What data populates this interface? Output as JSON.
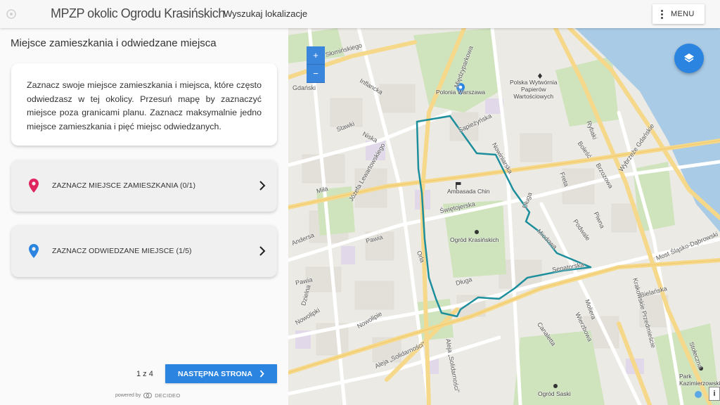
{
  "header": {
    "title": "MPZP okolic Ogrodu Krasińskich",
    "search_label": "Wyszukaj lokalizacje",
    "menu_label": "MENU"
  },
  "panel": {
    "heading": "Miejsce zamieszkania i odwiedzane miejsca",
    "instructions": "Zaznacz swoje miejsce zamieszkania i miejsca, które często odwiedzasz w tej okolicy. Przesuń mapę by zaznaczyć miejsce poza granicami planu. Zaznacz maksymalnie jedno miejsce zamieszkania i pięć miejsc odwiedzanych.",
    "home_action": "ZAZNACZ MIEJSCE ZAMIESZKANIA (0/1)",
    "visited_action": "ZAZNACZ ODWIEDZANE MIEJSCE (1/5)",
    "pager": "1 z 4",
    "next_label": "NASTĘPNA STRONA",
    "powered_by": "powered by",
    "powered_brand": "DECIDEO"
  },
  "map": {
    "zoom_in": "+",
    "zoom_out": "−",
    "info": "i",
    "labels": {
      "stawki": "Stawki",
      "inflancka": "Inflancka",
      "niska": "Niska",
      "mila": "Miła",
      "jozefa": "Józefa Lewartowskiego",
      "pawia": "Pawia",
      "solidarnosci": "Aleja „Solidarności”",
      "solidarnosci2": "Aleja „Solidarności”",
      "nowolipie": "Nowolipie",
      "nowolipki": "Nowolipki",
      "dluga": "Długa",
      "dluga2": "Długa",
      "swietojerska": "Świętojerska",
      "sapiezynska": "Sapieżyńska",
      "freta": "Freta",
      "bolesc": "Boleść",
      "rybaki": "Rybaki",
      "brzozowa": "Brzozowa",
      "piwna": "Piwna",
      "podwale": "Podwale",
      "miodowa": "Miodowa",
      "senatorska": "Senatorska",
      "bielanska": "Bielańska",
      "wierzbowa": "Wierzbowa",
      "canaletta": "Canaletta",
      "moliera": "Moliera",
      "krakowskie": "Krakowskie Przedmieście",
      "slaskodab": "Most Śląsko-Dąbrowski",
      "wybrzeze": "Wybrzeże Gdańskie",
      "stolorska": "Stołeczna",
      "miedzyparkowa": "Międzyparkowa",
      "andersa": "Andersa",
      "orla": "Orla",
      "dzielna": "Dzielna",
      "pawia2": "Pawia",
      "nowiniarska": "Nowiniarska",
      "gdanski": "Gdański",
      "stalowa": "Słomińskiego"
    },
    "pois": {
      "polonia": "Polonia Warszawa",
      "papiernia": "Polska Wytwórnia\nPapierów\nWartościowych",
      "ambasada": "Ambasada Chin",
      "ogrod_k": "Ogród Krasińskich",
      "ogrod_s": "Ogród Saski",
      "park_k": "Park\nKazimierzowski"
    },
    "colors": {
      "boundary": "#1d8f9c",
      "road": "#f6d88a",
      "park": "#cfe3bd",
      "water": "#a9cbe6",
      "pin_home": "#e0245e",
      "pin_visit": "#2a84e0"
    }
  }
}
